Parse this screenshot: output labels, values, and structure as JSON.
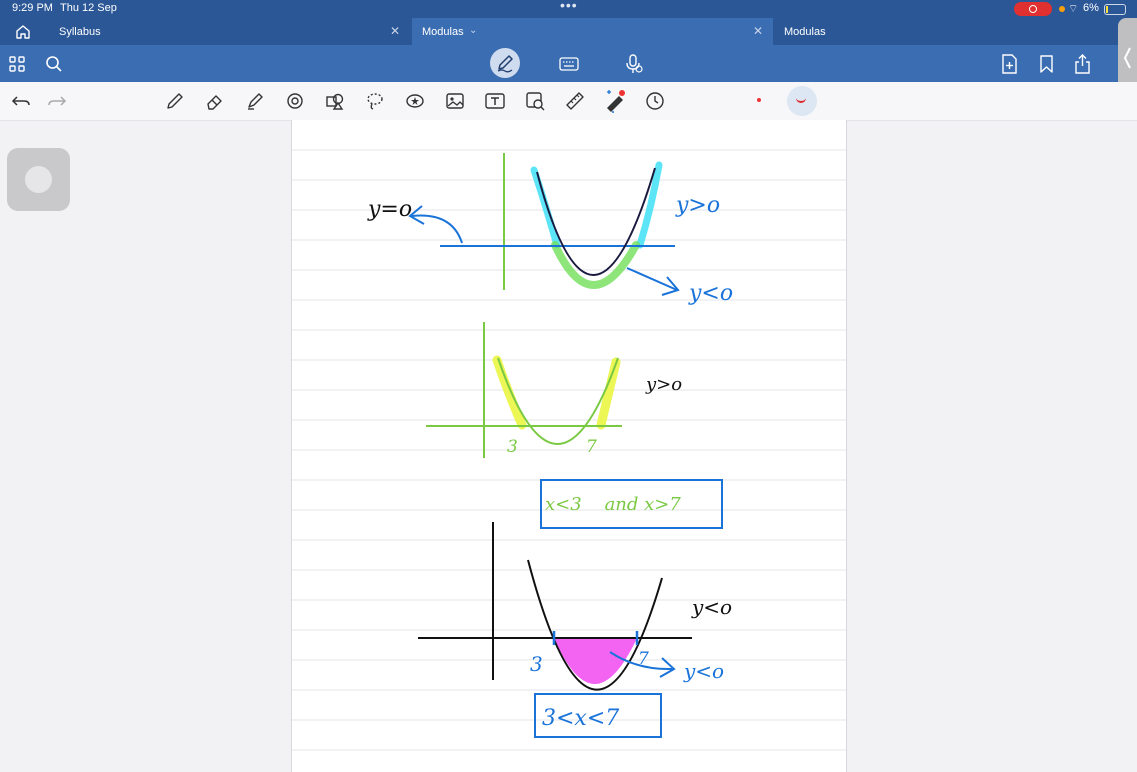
{
  "status": {
    "time": "9:29 PM",
    "date": "Thu 12 Sep",
    "battery": "6%"
  },
  "tabs": [
    {
      "label": "Syllabus"
    },
    {
      "label": "Modulas"
    },
    {
      "label": "Modulas"
    }
  ],
  "note": {
    "graph1": {
      "label_left": "y=o",
      "label_right_top": "y>o",
      "label_right_bottom": "y<o"
    },
    "graph2": {
      "label_right": "y>o",
      "root1": "3",
      "root2": "7",
      "answer": "x<3    and x>7"
    },
    "graph3": {
      "label_right_top": "y<o",
      "root1": "3",
      "root2": "7",
      "label_right_bottom": "y<o",
      "answer": "3<x<7"
    }
  },
  "colors": {
    "header": "#2b5797",
    "appbar": "#3a6db2",
    "ink_blue": "#1a73d9",
    "ink_green": "#7ac943",
    "highlight_cyan": "#3fe0f5",
    "highlight_green": "#72e05a",
    "highlight_yellow": "#eaf542",
    "fill_magenta": "#f25cf2"
  }
}
